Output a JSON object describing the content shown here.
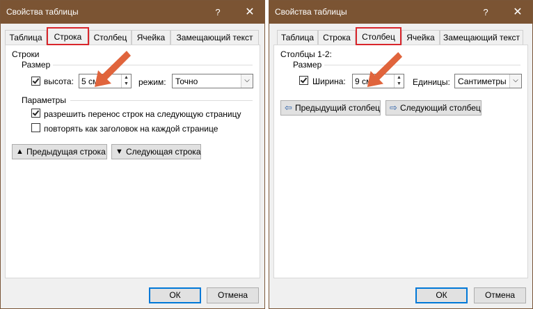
{
  "left": {
    "title": "Свойства таблицы",
    "help": "?",
    "close": "✕",
    "tabs": [
      {
        "label": "Таблица"
      },
      {
        "label": "Строка"
      },
      {
        "label": "Столбец"
      },
      {
        "label": "Ячейка"
      },
      {
        "label": "Замещающий текст"
      }
    ],
    "active_tab": "Строка",
    "section_title": "Строки",
    "size_group": "Размер",
    "height_label": "высота:",
    "height_checked": true,
    "height_value": "5 см",
    "mode_label": "режим:",
    "mode_value": "Точно",
    "params_group": "Параметры",
    "opt_allow_break": "разрешить перенос строк на следующую страницу",
    "opt_allow_break_checked": true,
    "opt_repeat_header": "повторять как заголовок на каждой странице",
    "opt_repeat_header_checked": false,
    "prev_button": "Предыдущая строка",
    "next_button": "Следующая строка",
    "ok": "ОК",
    "cancel": "Отмена"
  },
  "right": {
    "title": "Свойства таблицы",
    "help": "?",
    "close": "✕",
    "tabs": [
      {
        "label": "Таблица"
      },
      {
        "label": "Строка"
      },
      {
        "label": "Столбец"
      },
      {
        "label": "Ячейка"
      },
      {
        "label": "Замещающий текст"
      }
    ],
    "active_tab": "Столбец",
    "section_title": "Столбцы 1-2:",
    "size_group": "Размер",
    "width_label": "Ширина:",
    "width_checked": true,
    "width_value": "9 см",
    "units_label": "Единицы:",
    "units_value": "Сантиметры",
    "prev_button": "Предыдущий столбец",
    "next_button": "Следующий столбец",
    "ok": "ОК",
    "cancel": "Отмена"
  },
  "colors": {
    "titlebar": "#7b5433",
    "active_tab_border": "#d9262c",
    "annotation_arrow": "#e0643c",
    "ok_border": "#0078d7"
  }
}
